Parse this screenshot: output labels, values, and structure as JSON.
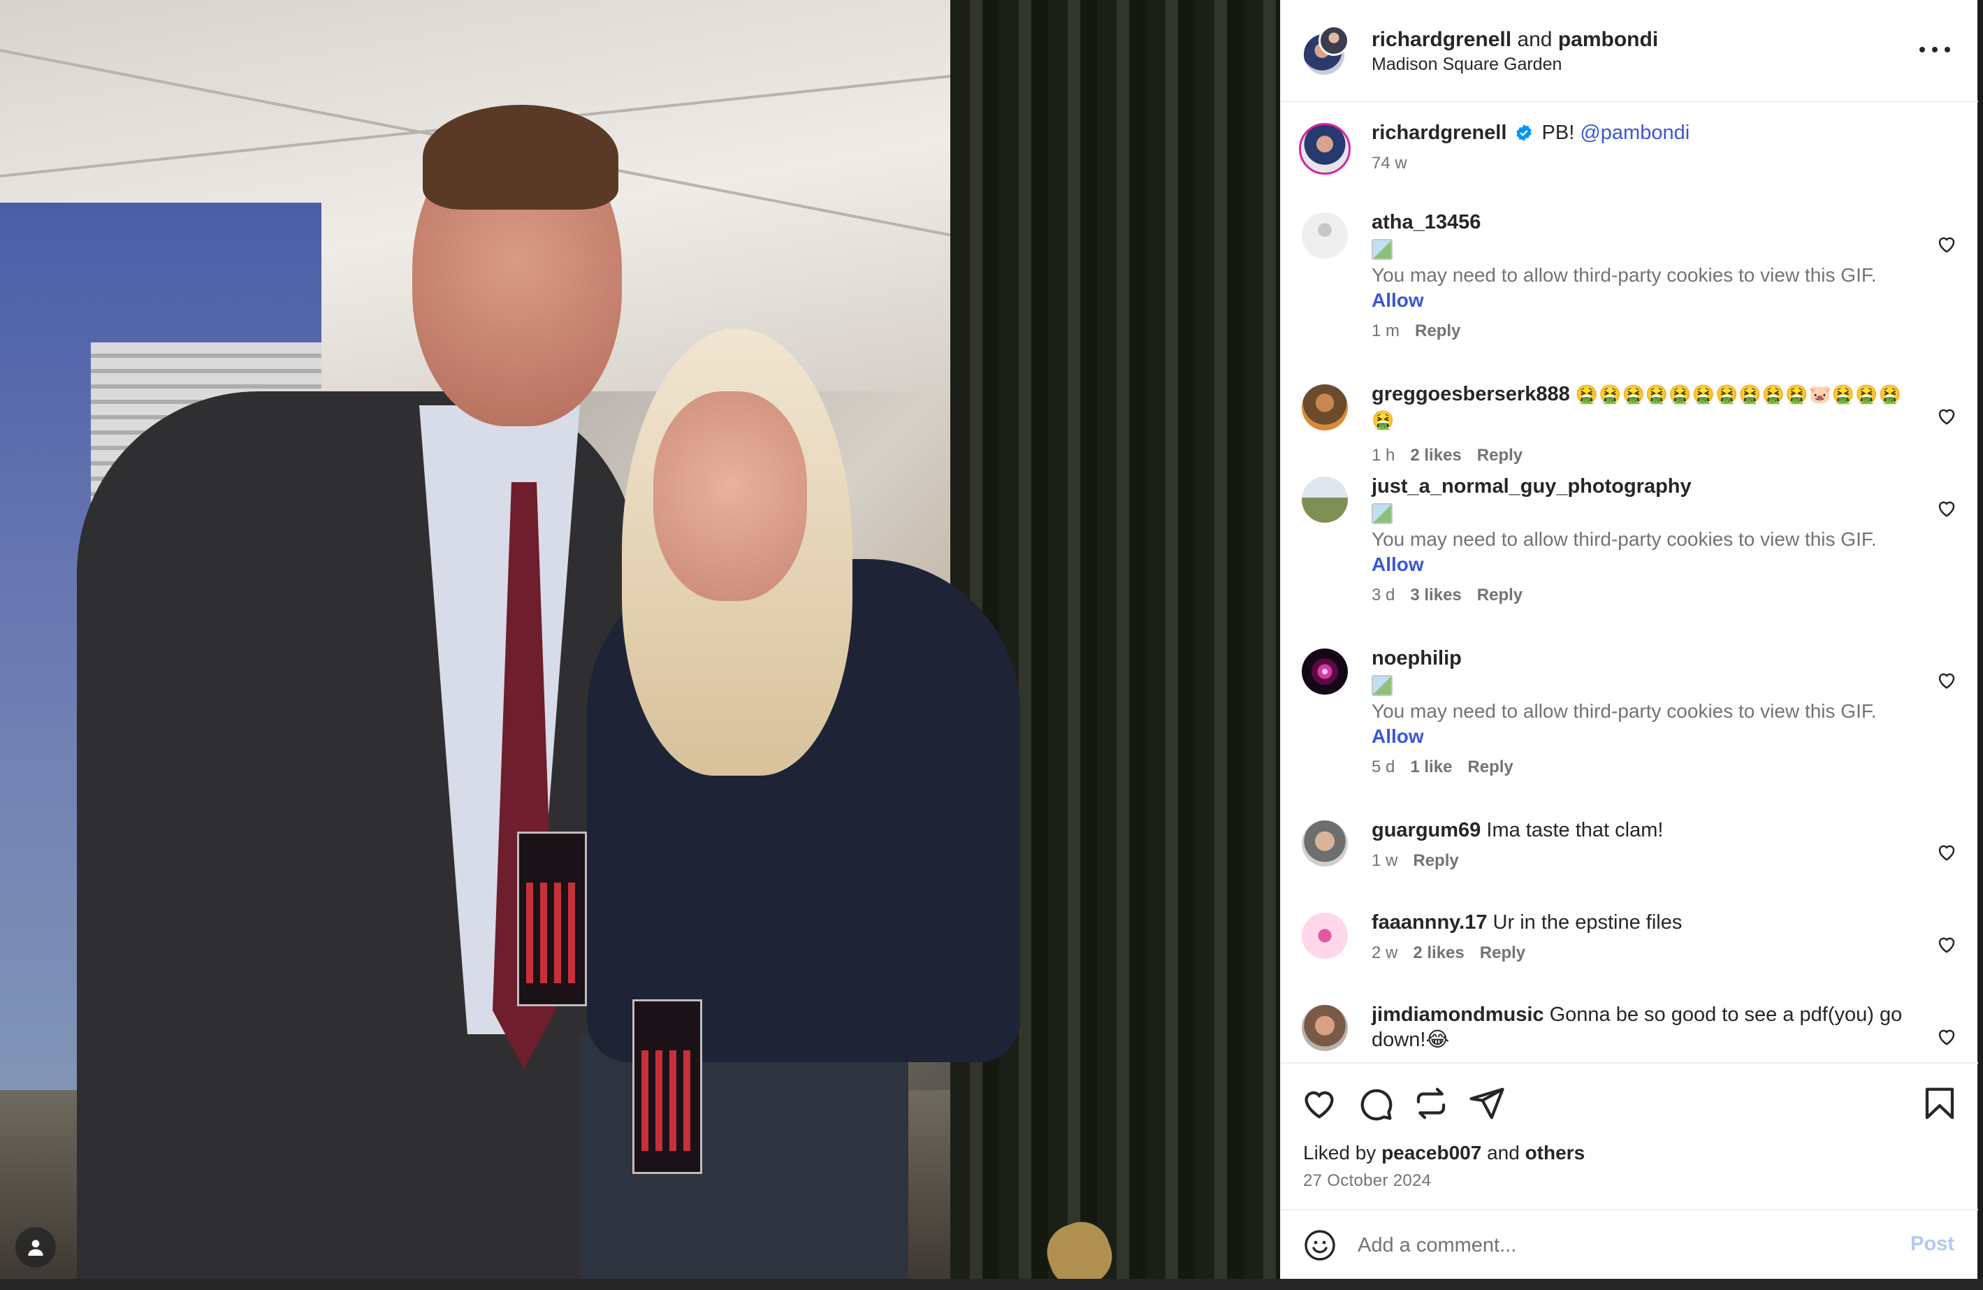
{
  "post": {
    "author_names": {
      "first": "richardgrenell",
      "joiner": "and",
      "second": "pambondi"
    },
    "location": "Madison Square Garden",
    "more_icon": "more-horizontal-icon"
  },
  "caption": {
    "user": "richardgrenell",
    "verified_icon": "verified-badge-icon",
    "text": "PB!",
    "mention": "@pambondi",
    "time": "74 w"
  },
  "comments": [
    {
      "user": "atha_13456",
      "text": "",
      "gif_message": "You may need to allow third-party cookies to view this GIF.",
      "allow_label": "Allow",
      "time": "1 m",
      "likes": "",
      "reply": "Reply"
    },
    {
      "user": "greggoesberserk888",
      "text": "🤮🤮🤮🤮🤮🤮🤮🤮🤮🤮🐷🤮🤮🤮🤮",
      "gif_message": "",
      "allow_label": "",
      "time": "1 h",
      "likes": "2 likes",
      "reply": "Reply"
    },
    {
      "user": "just_a_normal_guy_photography",
      "text": "",
      "gif_message": "You may need to allow third-party cookies to view this GIF.",
      "allow_label": "Allow",
      "time": "3 d",
      "likes": "3 likes",
      "reply": "Reply"
    },
    {
      "user": "noephilip",
      "text": "",
      "gif_message": "You may need to allow third-party cookies to view this GIF.",
      "allow_label": "Allow",
      "time": "5 d",
      "likes": "1 like",
      "reply": "Reply"
    },
    {
      "user": "guargum69",
      "text": "Ima taste that clam!",
      "gif_message": "",
      "allow_label": "",
      "time": "1 w",
      "likes": "",
      "reply": "Reply"
    },
    {
      "user": "faaannny.17",
      "text": "Ur in the epstine files",
      "gif_message": "",
      "allow_label": "",
      "time": "2 w",
      "likes": "2 likes",
      "reply": "Reply"
    },
    {
      "user": "jimdiamondmusic",
      "text": "Gonna be so good to see a pdf(you) go down!😂",
      "gif_message": "",
      "allow_label": "",
      "time": "",
      "likes": "",
      "reply": ""
    }
  ],
  "actions": {
    "like_icon": "heart-icon",
    "comment_icon": "comment-icon",
    "repost_icon": "repost-icon",
    "share_icon": "send-icon",
    "save_icon": "bookmark-icon"
  },
  "likes_line": {
    "prefix": "Liked by",
    "user": "peaceb007",
    "joiner": "and",
    "others": "others"
  },
  "date": "27 October 2024",
  "add_comment": {
    "placeholder": "Add a comment...",
    "post_label": "Post",
    "emoji_icon": "emoji-icon"
  },
  "photo": {
    "user_tag_icon": "user-tag-icon"
  },
  "colors": {
    "link_blue": "#3b56d6",
    "muted": "#737373",
    "post_disabled": "#b2c9f5",
    "verified": "#0095f6"
  }
}
